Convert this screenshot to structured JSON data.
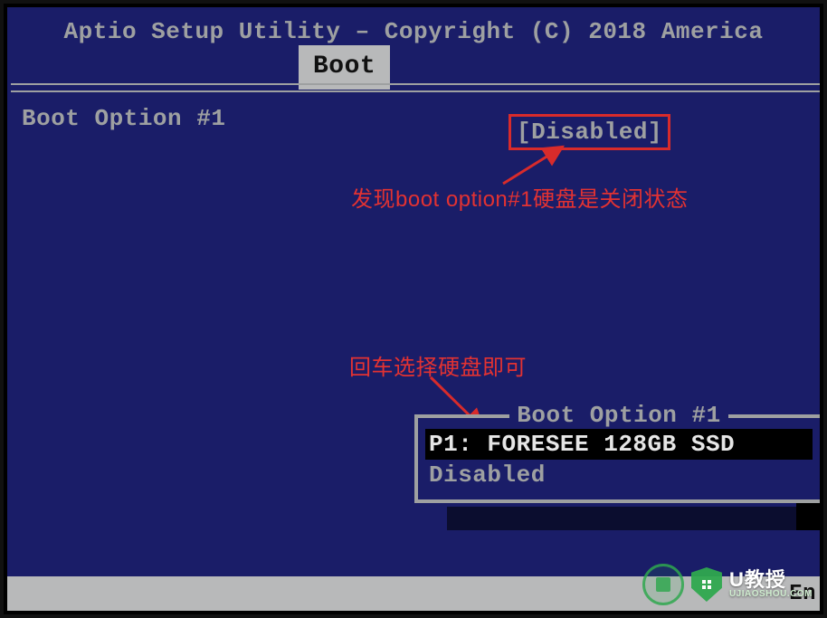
{
  "header": {
    "title": "Aptio Setup Utility – Copyright (C) 2018 America"
  },
  "tab": {
    "label": "Boot"
  },
  "option": {
    "label": "Boot Option #1",
    "value": "[Disabled]"
  },
  "annotations": {
    "note_disabled": "发现boot option#1硬盘是关闭状态",
    "note_select": "回车选择硬盘即可"
  },
  "popup": {
    "title": "Boot Option #1",
    "items": [
      {
        "label": "P1: FORESEE 128GB SSD",
        "selected": true
      },
      {
        "label": "Disabled",
        "selected": false
      }
    ]
  },
  "helpbar": {
    "right_hint": "En"
  },
  "watermark": {
    "brand": "U教授",
    "url": "UJIAOSHOU.COM"
  },
  "colors": {
    "blue": "#1a1d68",
    "grey": "#9ea0a1",
    "red": "#d82b2b"
  }
}
